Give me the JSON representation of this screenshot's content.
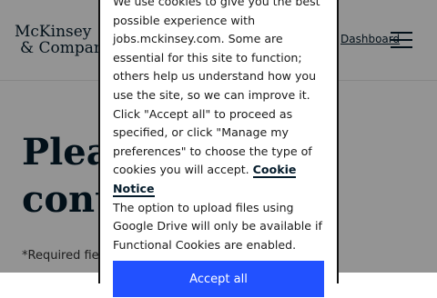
{
  "header": {
    "logo_line1": "McKinsey",
    "logo_line2": "& Company",
    "dashboard_link": "Dashboard",
    "menu_icon": "hamburger-menu-icon"
  },
  "main": {
    "headline_line1": "Please",
    "headline_line2": "continue",
    "required_note": "*Required fields"
  },
  "cookie_dialog": {
    "text1": "We use cookies to give you the best possible experience with jobs.mckinsey.com. Some are essential for this site to function; others help us understand how you use the site, so we can improve it.",
    "text2": "Click \"Accept all\" to proceed as specified, or click \"Manage my preferences\" to choose the type of cookies you will accept.",
    "notice_link": "Cookie Notice",
    "text3": "The option to upload files using Google Drive will only be available if Functional Cookies are enabled.",
    "accept_button": "Accept all"
  },
  "colors": {
    "brand_navy": "#051c2c",
    "accent_blue": "#2251ff"
  }
}
